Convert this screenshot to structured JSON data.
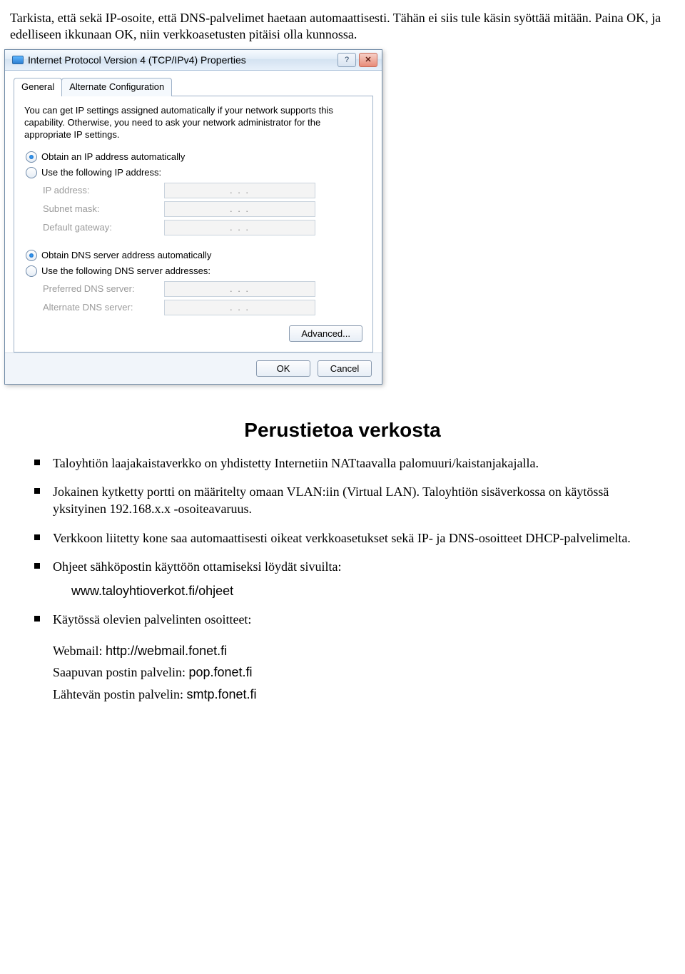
{
  "intro_text": "Tarkista, että sekä IP-osoite, että DNS-palvelimet haetaan automaattisesti. Tähän ei siis tule käsin syöttää mitään. Paina OK, ja edelliseen ikkunaan OK, niin verkkoasetusten pitäisi olla kunnossa.",
  "dialog": {
    "title": "Internet Protocol Version 4 (TCP/IPv4) Properties",
    "help_icon": "?",
    "close_icon": "✕",
    "tabs": {
      "general": "General",
      "alternate": "Alternate Configuration"
    },
    "description": "You can get IP settings assigned automatically if your network supports this capability. Otherwise, you need to ask your network administrator for the appropriate IP settings.",
    "radio_ip_auto": "Obtain an IP address automatically",
    "radio_ip_manual": "Use the following IP address:",
    "ip_fields": {
      "ip": "IP address:",
      "subnet": "Subnet mask:",
      "gateway": "Default gateway:"
    },
    "radio_dns_auto": "Obtain DNS server address automatically",
    "radio_dns_manual": "Use the following DNS server addresses:",
    "dns_fields": {
      "preferred": "Preferred DNS server:",
      "alternate": "Alternate DNS server:"
    },
    "ip_placeholder": ".       .       .",
    "advanced_btn": "Advanced...",
    "ok_btn": "OK",
    "cancel_btn": "Cancel"
  },
  "section_heading": "Perustietoa verkosta",
  "bullets": {
    "b1": "Taloyhtiön laajakaistaverkko on yhdistetty Internetiin NATtaavalla palomuuri/kaistanjakajalla.",
    "b2": "Jokainen kytketty portti on määritelty omaan VLAN:iin (Virtual LAN). Taloyhtiön sisäverkossa on käytössä yksityinen 192.168.x.x -osoiteavaruus.",
    "b3": "Verkkoon liitetty kone saa automaattisesti oikeat verkkoasetukset sekä IP- ja DNS-osoitteet DHCP-palvelimelta.",
    "b4": "Ohjeet sähköpostin käyttöön ottamiseksi löydät sivuilta:",
    "b4_link": "www.taloyhtioverkot.fi/ohjeet",
    "b5": "Käytössä olevien palvelinten osoitteet:"
  },
  "servers": {
    "webmail_label": "Webmail: ",
    "webmail_val": "http://webmail.fonet.fi",
    "incoming_label": "Saapuvan postin palvelin: ",
    "incoming_val": "pop.fonet.fi",
    "outgoing_label": "Lähtevän postin palvelin: ",
    "outgoing_val": "smtp.fonet.fi"
  }
}
